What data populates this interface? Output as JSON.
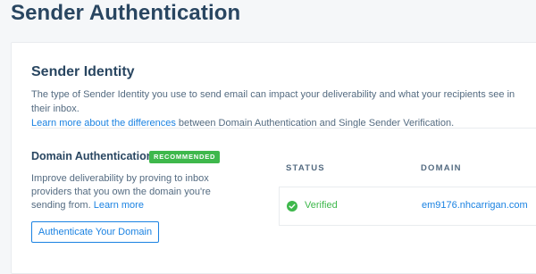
{
  "page": {
    "title": "Sender Authentication"
  },
  "sender_identity": {
    "title": "Sender Identity",
    "description": "The type of Sender Identity you use to send email can impact your deliverability and what your recipients see in their inbox.",
    "learn_more_link": "Learn more about the differences",
    "learn_more_suffix": " between Domain Authentication and Single Sender Verification."
  },
  "domain_authentication": {
    "title": "Domain Authentication",
    "badge": "RECOMMENDED",
    "description": "Improve deliverability by proving to inbox providers that you own the domain you're sending from. ",
    "learn_more_link": "Learn more",
    "button_label": "Authenticate Your Domain"
  },
  "table": {
    "columns": [
      "STATUS",
      "DOMAIN"
    ],
    "rows": [
      {
        "status": "Verified",
        "domain": "em9176.nhcarrigan.com"
      }
    ]
  },
  "colors": {
    "primary_text": "#294661",
    "link": "#1a82e2",
    "success": "#3eb84c"
  },
  "icons": {
    "status_verified": "check-circle-icon"
  }
}
